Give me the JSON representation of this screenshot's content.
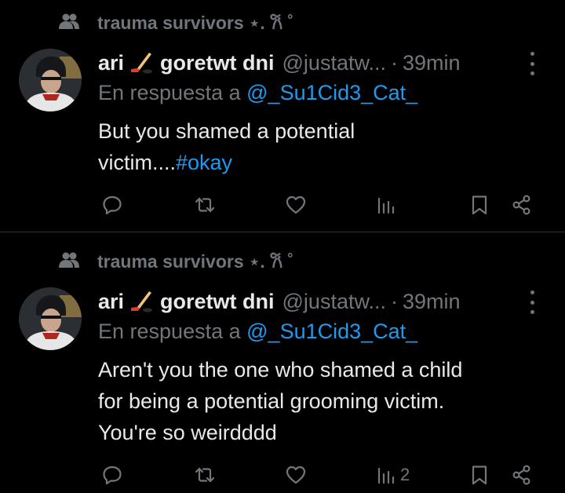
{
  "icons": {
    "context": "people-icon",
    "badge": "hockey-stick-emoji",
    "more": "more-dots-icon",
    "reply": "reply-icon",
    "retweet": "retweet-icon",
    "like": "heart-icon",
    "views": "views-icon",
    "bookmark": "bookmark-icon",
    "share": "share-icon"
  },
  "colors": {
    "background": "#000000",
    "text": "#e7e9ea",
    "muted": "#71767b",
    "link": "#1d9bf0",
    "divider": "#2f3336"
  },
  "tweets": [
    {
      "context": "trauma survivors ⋆. 𐙚 ˚",
      "name_pre": "ari",
      "name_post": "goretwt dni",
      "handle": "@justatw...",
      "dot": "·",
      "time": "39min",
      "reply_prefix": "En respuesta a",
      "reply_mention": "@_Su1Cid3_Cat_",
      "line1": "But you shamed a potential",
      "line2": "victim....",
      "hashtag": "#okay",
      "views_count": ""
    },
    {
      "context": "trauma survivors ⋆. 𐙚 ˚",
      "name_pre": "ari",
      "name_post": "goretwt dni",
      "handle": "@justatw...",
      "dot": "·",
      "time": "39min",
      "reply_prefix": "En respuesta a",
      "reply_mention": "@_Su1Cid3_Cat_",
      "line1": "Aren't you the one who shamed a child",
      "line2": "for being a potential grooming victim.",
      "line3": "You're so weirdddd",
      "views_count": "2"
    }
  ]
}
